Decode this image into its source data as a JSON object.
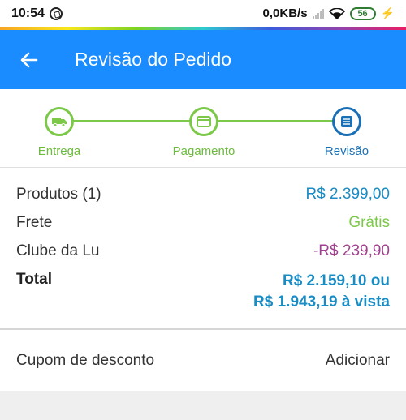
{
  "status_bar": {
    "time": "10:54",
    "network_speed": "0,0KB/s",
    "battery": "56",
    "icons": [
      "whatsapp-icon",
      "signal-icon",
      "wifi-icon",
      "battery-icon",
      "charging-icon"
    ]
  },
  "colors": {
    "app_bar": "#1a8cff",
    "step_active_green": "#7cc94a",
    "step_current_blue": "#1a6fb5",
    "price_blue": "#1a8cc4",
    "free_green": "#7cc94a",
    "discount_purple": "#a0418f"
  },
  "app_bar": {
    "title": "Revisão do Pedido",
    "back_icon": "arrow-left-icon"
  },
  "stepper": {
    "steps": [
      {
        "label": "Entrega",
        "icon": "truck-icon",
        "state": "done"
      },
      {
        "label": "Pagamento",
        "icon": "credit-card-icon",
        "state": "done"
      },
      {
        "label": "Revisão",
        "icon": "list-icon",
        "state": "current"
      }
    ]
  },
  "summary": {
    "rows": [
      {
        "label": "Produtos (1)",
        "value": "R$ 2.399,00"
      },
      {
        "label": "Frete",
        "value": "Grátis"
      },
      {
        "label": "Clube da Lu",
        "value": "-R$ 239,90"
      }
    ],
    "total": {
      "label": "Total",
      "value_line1": "R$ 2.159,10 ou",
      "value_line2": "R$ 1.943,19 à vista"
    }
  },
  "coupon": {
    "label": "Cupom de desconto",
    "action": "Adicionar"
  }
}
